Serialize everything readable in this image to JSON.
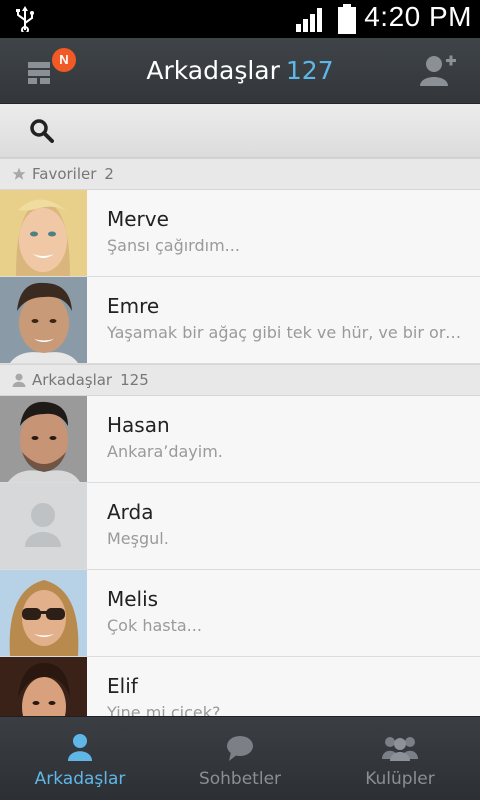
{
  "status_bar": {
    "time": "4:20 PM"
  },
  "header": {
    "title": "Arkadaşlar",
    "count": "127",
    "notification_badge": "N",
    "icons": [
      "menu-icon",
      "add-friend-icon"
    ]
  },
  "search": {
    "icon": "search-icon"
  },
  "sections": {
    "favorites": {
      "label": "Favoriler",
      "count": "2"
    },
    "friends": {
      "label": "Arkadaşlar",
      "count": "125"
    }
  },
  "contacts": [
    {
      "name": "Merve",
      "status": "Şansı çağırdım...",
      "avatar": "photo"
    },
    {
      "name": "Emre",
      "status": "Yaşamak bir ağaç gibi tek ve hür, ve bir orma...",
      "avatar": "photo"
    },
    {
      "name": "Hasan",
      "status": "Ankara’dayim.",
      "avatar": "photo"
    },
    {
      "name": "Arda",
      "status": "Meşgul.",
      "avatar": "placeholder"
    },
    {
      "name": "Melis",
      "status": "Çok hasta...",
      "avatar": "photo"
    },
    {
      "name": "Elif",
      "status": "Yine mi cicek?",
      "avatar": "photo"
    }
  ],
  "tabs": [
    {
      "label": "Arkadaşlar",
      "icon": "person-icon",
      "active": true
    },
    {
      "label": "Sohbetler",
      "icon": "chat-bubble-icon",
      "active": false
    },
    {
      "label": "Kulüpler",
      "icon": "group-icon",
      "active": false
    }
  ],
  "colors": {
    "accent": "#5fb7e8",
    "badge": "#f15a24",
    "header": "#3a3e42"
  }
}
